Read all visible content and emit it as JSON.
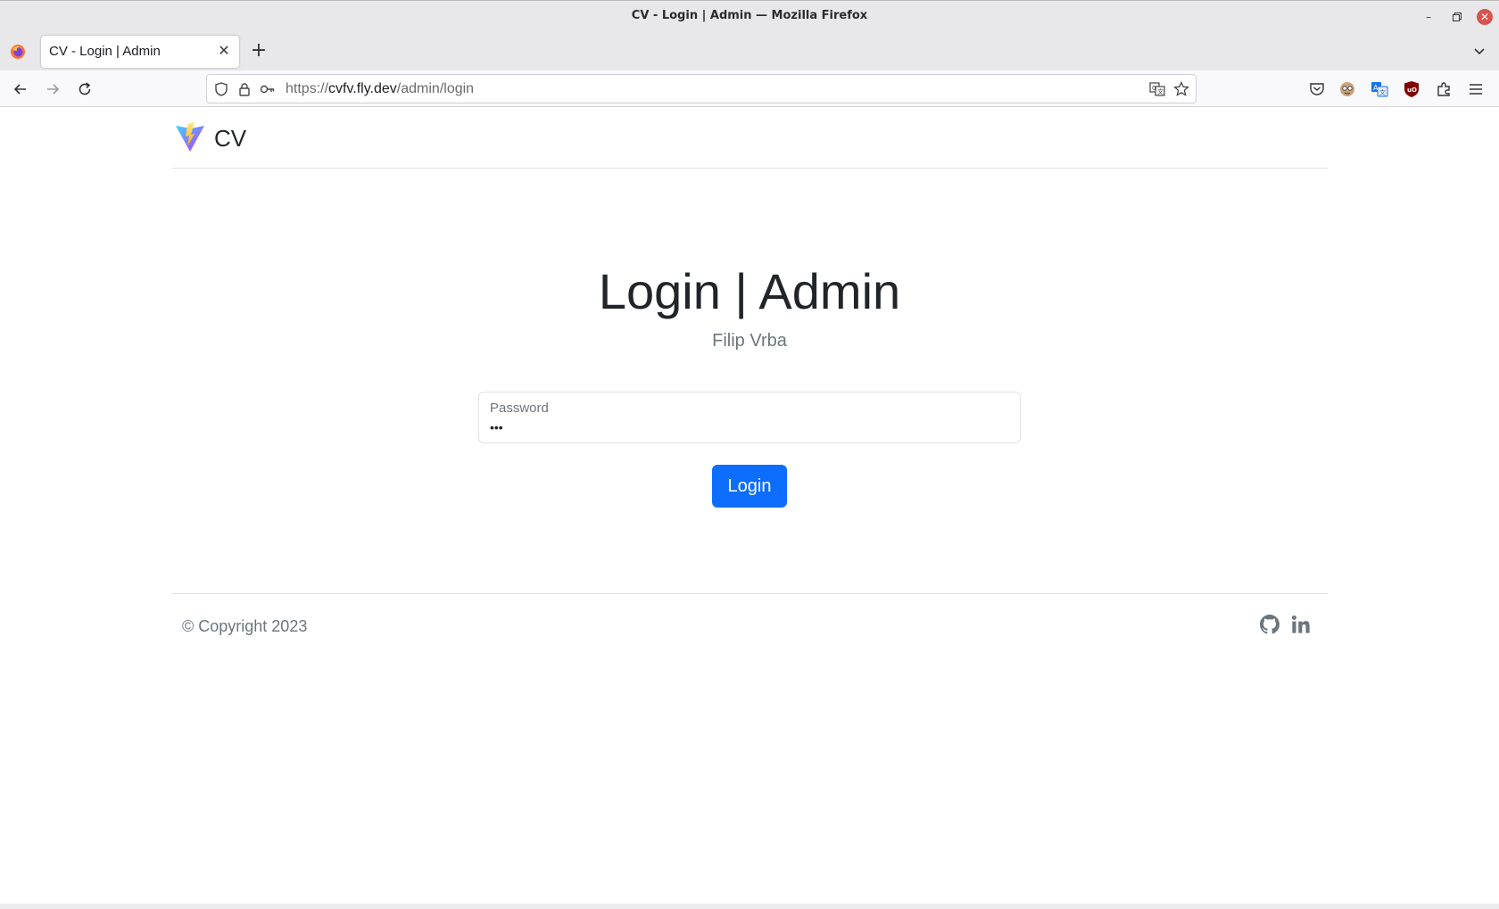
{
  "window": {
    "title": "CV - Login | Admin — Mozilla Firefox"
  },
  "browser": {
    "tab_title": "CV - Login | Admin",
    "url_scheme": "https://",
    "url_host": "cvfv.fly.dev",
    "url_path": "/admin/login"
  },
  "header": {
    "brand": "CV"
  },
  "main": {
    "title": "Login | Admin",
    "subtitle": "Filip Vrba",
    "password_label": "Password",
    "password_value": "•••",
    "login_button": "Login"
  },
  "footer": {
    "copyright": "© Copyright 2023"
  },
  "colors": {
    "primary": "#0d6efd",
    "text": "#212529",
    "muted": "#6c757d"
  },
  "icons": [
    "firefox-icon",
    "close-icon",
    "plus-icon",
    "chevron-down-icon",
    "back-icon",
    "forward-icon",
    "reload-icon",
    "shield-icon",
    "lock-icon",
    "key-icon",
    "translate-icon",
    "star-icon",
    "pocket-icon",
    "extension-icon",
    "ublock-icon",
    "puzzle-icon",
    "menu-icon",
    "vite-logo-icon",
    "github-icon",
    "linkedin-icon"
  ]
}
